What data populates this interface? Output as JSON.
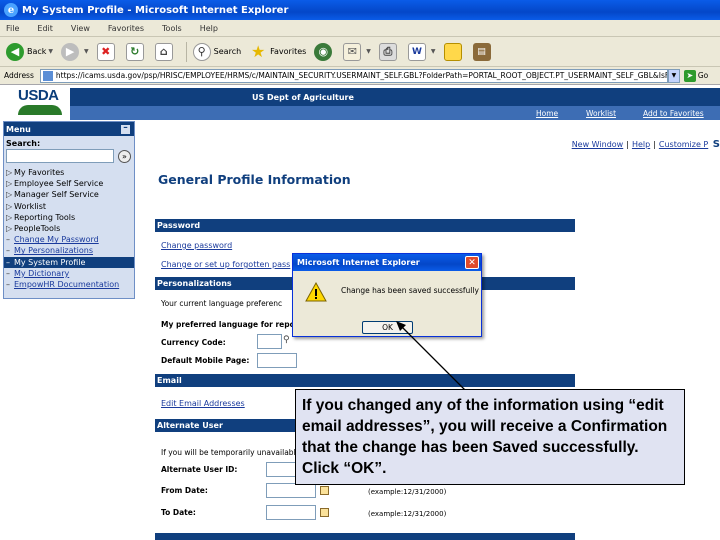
{
  "window": {
    "title": "My System Profile - Microsoft Internet Explorer"
  },
  "menubar": [
    "File",
    "Edit",
    "View",
    "Favorites",
    "Tools",
    "Help"
  ],
  "toolbar": {
    "back": "Back",
    "search": "Search",
    "favorites": "Favorites"
  },
  "addressbar": {
    "label": "Address",
    "url": "https://icams.usda.gov/psp/HRISC/EMPLOYEE/HRMS/c/MAINTAIN_SECURITY.USERMAINT_SELF.GBL?FolderPath=PORTAL_ROOT_OBJECT.PT_USERMAINT_SELF_GBL&IsF",
    "go": "Go"
  },
  "header": {
    "logo": "USDA",
    "agency": "US Dept of Agriculture",
    "links": {
      "home": "Home",
      "worklist": "Worklist",
      "add_favorites": "Add to Favorites"
    }
  },
  "topnav": {
    "new_window": "New Window",
    "help": "Help",
    "customize": "Customize P",
    "trailing": "S"
  },
  "menu": {
    "title": "Menu",
    "search_label": "Search:",
    "items": [
      {
        "label": "My Favorites"
      },
      {
        "label": "Employee Self Service"
      },
      {
        "label": "Manager Self Service"
      },
      {
        "label": "Worklist"
      },
      {
        "label": "Reporting Tools"
      },
      {
        "label": "PeopleTools"
      },
      {
        "label": "Change My Password"
      },
      {
        "label": "My Personalizations"
      },
      {
        "label": "My System Profile"
      },
      {
        "label": "My Dictionary"
      },
      {
        "label": "EmpowHR Documentation"
      }
    ]
  },
  "main": {
    "title": "General Profile Information",
    "password": {
      "header": "Password",
      "change_password": "Change password",
      "change_forgotten": "Change or set up forgotten pass"
    },
    "personalizations": {
      "header": "Personalizations",
      "current_language": "Your current language preferenc",
      "preferred_language": "My preferred language for repo",
      "currency_code": "Currency Code:",
      "mobile_page": "Default Mobile Page:"
    },
    "email": {
      "header": "Email",
      "edit_link": "Edit Email Addresses"
    },
    "alternate_user": {
      "header": "Alternate User",
      "note": "If you will be temporarily unavailable,",
      "alt_user_id": "Alternate User ID:",
      "from_date": "From Date:",
      "to_date": "To Date:",
      "example": "(example:12/31/2000)"
    }
  },
  "dialog": {
    "title": "Microsoft Internet Explorer",
    "message": "Change has been saved successfully",
    "ok": "OK"
  },
  "callout": {
    "text": "If you changed any of the information using “edit email addresses”, you will receive a Confirmation that the change has been Saved successfully.  Click “OK”."
  }
}
